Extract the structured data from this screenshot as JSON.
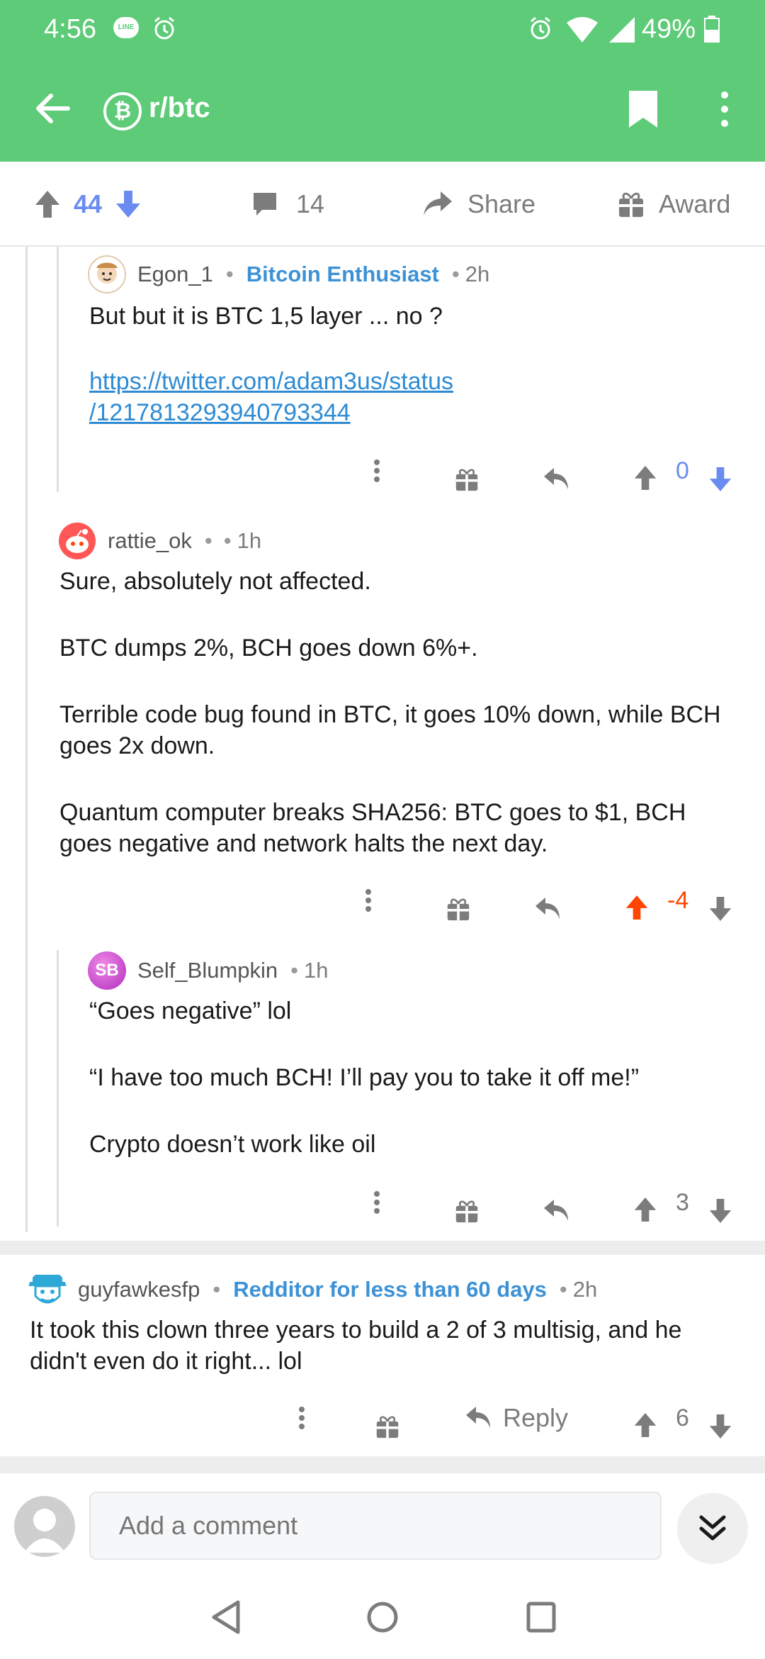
{
  "status_bar": {
    "time": "4:56",
    "line_label": "LINE",
    "battery": "49%"
  },
  "app_bar": {
    "subreddit_icon": "₿",
    "subreddit": "r/btc"
  },
  "post_actions": {
    "upvotes": "44",
    "comments": "14",
    "share_label": "Share",
    "award_label": "Award"
  },
  "comments": [
    {
      "username": "Egon_1",
      "flair": "Bitcoin Enthusiast",
      "time": "2h",
      "paragraphs": [
        "But but it is BTC 1,5 layer ... no ?"
      ],
      "link_line1": "https://twitter.com/adam3us/status",
      "link_line2": "/1217813293940793344",
      "score": "0"
    },
    {
      "username": "rattie_ok",
      "time": "1h",
      "paragraphs": [
        "Sure, absolutely not affected.",
        "BTC dumps 2%, BCH goes down 6%+.",
        "Terrible code bug found in BTC, it goes 10% down, while BCH goes 2x down.",
        "Quantum computer breaks SHA256: BTC goes to $1, BCH goes negative and network halts the next day."
      ],
      "score": "-4"
    },
    {
      "username": "Self_Blumpkin",
      "avatar_text": "SB",
      "time": "1h",
      "paragraphs": [
        "“Goes negative” lol",
        "“I have too much BCH! I’ll pay you to take it off me!”",
        "Crypto doesn’t work like oil"
      ],
      "score": "3"
    },
    {
      "username": "guyfawkesfp",
      "flair": "Redditor for less than 60 days",
      "time": "2h",
      "paragraphs": [
        "It took this clown three years to build a 2 of 3 multisig, and he didn't even do it right... lol"
      ],
      "reply_label": "Reply",
      "score": "6"
    }
  ],
  "comment_bar": {
    "placeholder": "Add a comment"
  },
  "colors": {
    "header_green": "#5ecb78",
    "upvote_blue": "#6a8cf0",
    "downvote_orange": "#ff4500",
    "link_blue": "#2e8bd3"
  }
}
